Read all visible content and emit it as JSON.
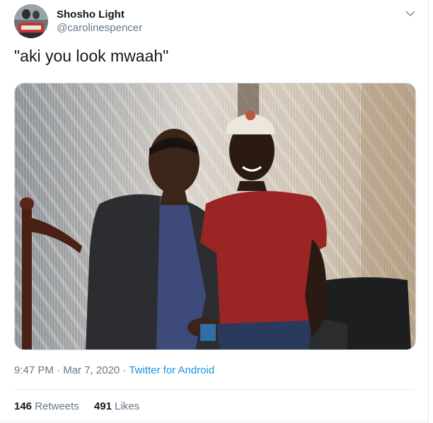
{
  "author": {
    "display_name": "Shosho Light",
    "handle": "@carolinespencer"
  },
  "tweet": {
    "text": "\"aki you look mwaah\"",
    "time": "9:47 PM",
    "date": "Mar 7, 2020",
    "source": "Twitter for Android",
    "separator": "·"
  },
  "stats": {
    "retweets_count": "146",
    "retweets_label": "Retweets",
    "likes_count": "491",
    "likes_label": "Likes"
  },
  "icons": {
    "menu": "chevron-down-icon"
  }
}
